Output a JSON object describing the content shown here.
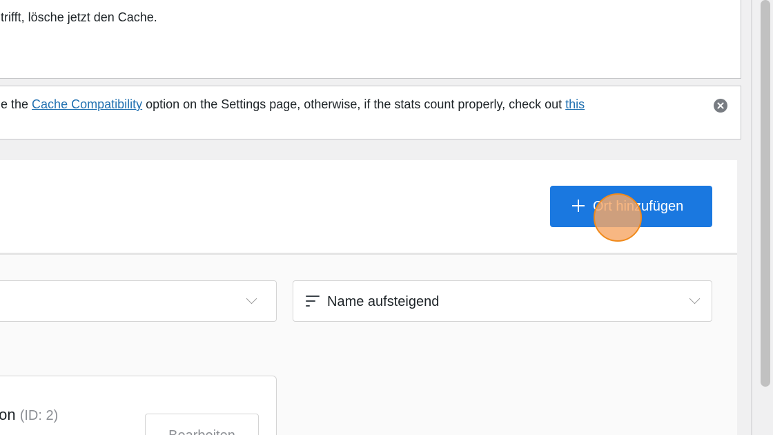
{
  "notices": {
    "cache_notice_top": {
      "text": "trifft, lösche jetzt den Cache."
    },
    "cache_compat_notice": {
      "text_before": "e the ",
      "link_compat": "Cache Compatibility",
      "text_middle": " option on the Settings page, otherwise, if the stats count properly, check out ",
      "link_this": "this",
      "dismiss_icon": "close-circle-icon"
    }
  },
  "header": {
    "add_button": {
      "label": "Ort hinzufügen",
      "icon": "plus-icon",
      "color": "#1a78e0"
    }
  },
  "filters": {
    "left_select": {
      "value": ""
    },
    "sort_select": {
      "icon": "sort-icon",
      "value": "Name aufsteigend"
    }
  },
  "locations": [
    {
      "name_fragment": "fon",
      "id_label": "(ID: 2)",
      "edit_label": "Bearbeiten"
    }
  ],
  "overlay": {
    "click_indicator_color": "#f7a766"
  }
}
